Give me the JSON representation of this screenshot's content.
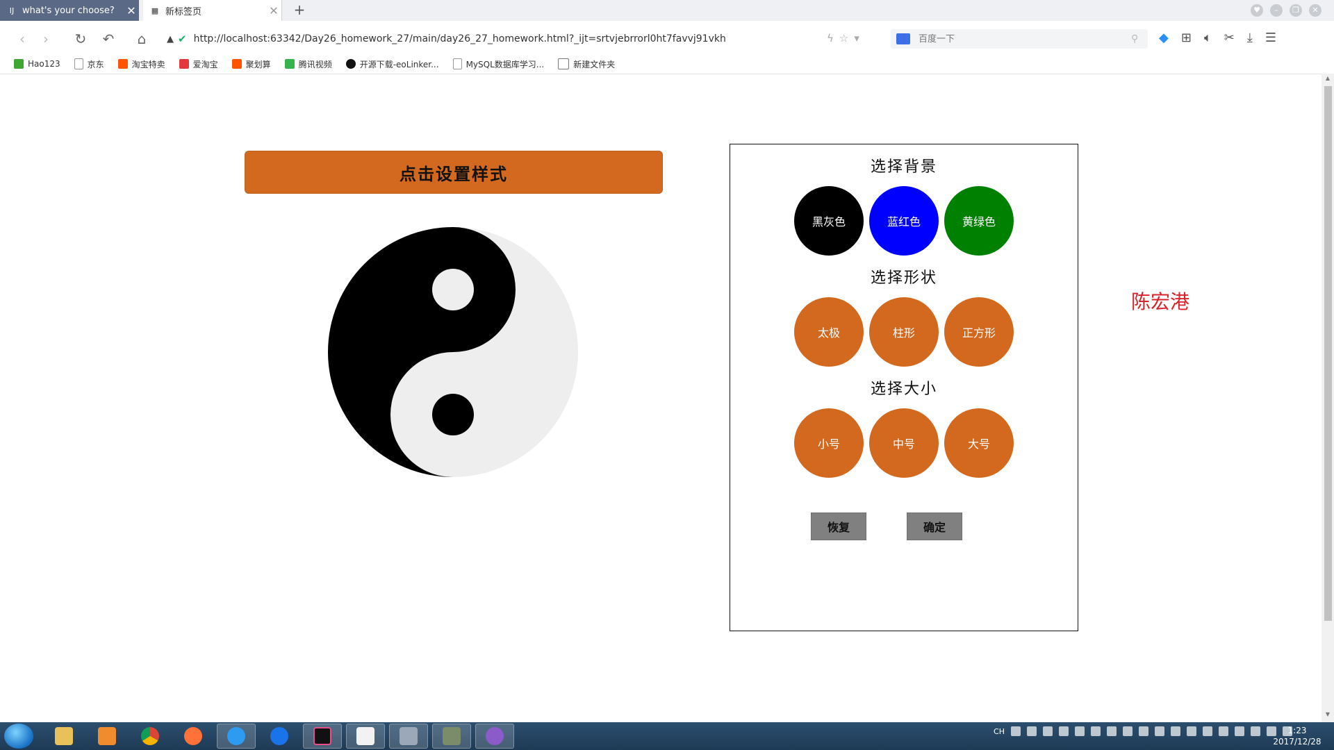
{
  "tabs": [
    {
      "favicon": "IJ",
      "title": "what's your choose?",
      "close": "✕"
    },
    {
      "favicon": "grid",
      "title": "新标签页",
      "close": "✕"
    }
  ],
  "new_tab_label": "+",
  "address": {
    "url": "http://localhost:63342/Day26_homework_27/main/day26_27_homework.html?_ijt=srtvjebrrorl0ht7favvj91vkh"
  },
  "search": {
    "placeholder": "百度一下"
  },
  "bookmarks": [
    {
      "label": "Hao123",
      "color": "#3fa535"
    },
    {
      "label": "京东",
      "color": "#999999"
    },
    {
      "label": "淘宝特卖",
      "color": "#ff5500"
    },
    {
      "label": "爱淘宝",
      "color": "#e4393c"
    },
    {
      "label": "聚划算",
      "color": "#ff5500"
    },
    {
      "label": "腾讯视频",
      "color": "#37b24d"
    },
    {
      "label": "开源下载-eoLinker...",
      "color": "#111111"
    },
    {
      "label": "MySQL数据库学习...",
      "color": "#999999"
    },
    {
      "label": "新建文件夹",
      "color": "#777777"
    }
  ],
  "main": {
    "set_style_button": "点击设置样式",
    "author": "陈宏港"
  },
  "panel": {
    "background_title": "选择背景",
    "background_options": [
      {
        "label": "黑灰色",
        "color": "#000000"
      },
      {
        "label": "蓝红色",
        "color": "#0000ff"
      },
      {
        "label": "黄绿色",
        "color": "#008000"
      }
    ],
    "shape_title": "选择形状",
    "shape_options": [
      {
        "label": "太极",
        "color": "#d2691e"
      },
      {
        "label": "柱形",
        "color": "#d2691e"
      },
      {
        "label": "正方形",
        "color": "#d2691e"
      }
    ],
    "size_title": "选择大小",
    "size_options": [
      {
        "label": "小号",
        "color": "#d2691e"
      },
      {
        "label": "中号",
        "color": "#d2691e"
      },
      {
        "label": "大号",
        "color": "#d2691e"
      }
    ],
    "reset_button": "恢复",
    "confirm_button": "确定"
  },
  "taiji": {
    "dark_color": "#000000",
    "light_color": "#eeeeee"
  },
  "tray": {
    "lang": "CH"
  },
  "clock": {
    "time": "1:23",
    "date": "2017/12/28"
  }
}
